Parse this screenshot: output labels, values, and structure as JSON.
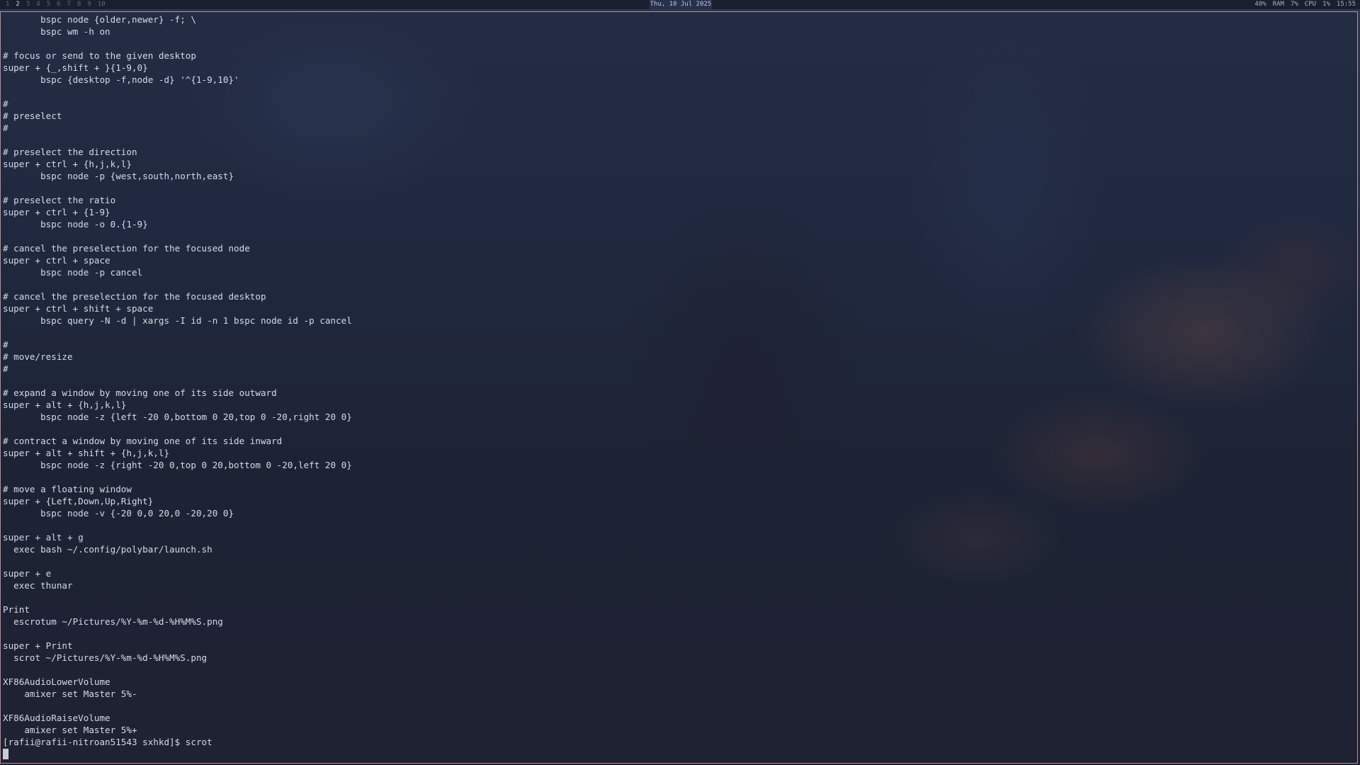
{
  "top_bar": {
    "workspaces": [
      "1",
      "2",
      "3",
      "4",
      "5",
      "6",
      "7",
      "8",
      "9",
      "10"
    ],
    "active_workspace": "2",
    "clock": "Thu, 10 Jul 2025",
    "stats": [
      "40%",
      "RAM",
      "7%",
      "CPU",
      "1%",
      "15:55"
    ]
  },
  "terminal": {
    "lines": [
      "       bspc node {older,newer} -f; \\",
      "       bspc wm -h on",
      "",
      "# focus or send to the given desktop",
      "super + {_,shift + }{1-9,0}",
      "       bspc {desktop -f,node -d} '^{1-9,10}'",
      "",
      "#",
      "# preselect",
      "#",
      "",
      "# preselect the direction",
      "super + ctrl + {h,j,k,l}",
      "       bspc node -p {west,south,north,east}",
      "",
      "# preselect the ratio",
      "super + ctrl + {1-9}",
      "       bspc node -o 0.{1-9}",
      "",
      "# cancel the preselection for the focused node",
      "super + ctrl + space",
      "       bspc node -p cancel",
      "",
      "# cancel the preselection for the focused desktop",
      "super + ctrl + shift + space",
      "       bspc query -N -d | xargs -I id -n 1 bspc node id -p cancel",
      "",
      "#",
      "# move/resize",
      "#",
      "",
      "# expand a window by moving one of its side outward",
      "super + alt + {h,j,k,l}",
      "       bspc node -z {left -20 0,bottom 0 20,top 0 -20,right 20 0}",
      "",
      "# contract a window by moving one of its side inward",
      "super + alt + shift + {h,j,k,l}",
      "       bspc node -z {right -20 0,top 0 20,bottom 0 -20,left 20 0}",
      "",
      "# move a floating window",
      "super + {Left,Down,Up,Right}",
      "       bspc node -v {-20 0,0 20,0 -20,20 0}",
      "",
      "super + alt + g",
      "  exec bash ~/.config/polybar/launch.sh",
      "",
      "super + e",
      "  exec thunar",
      "",
      "Print",
      "  escrotum ~/Pictures/%Y-%m-%d-%H%M%S.png",
      "",
      "super + Print",
      "  scrot ~/Pictures/%Y-%m-%d-%H%M%S.png",
      "",
      "XF86AudioLowerVolume",
      "    amixer set Master 5%-",
      "",
      "XF86AudioRaiseVolume",
      "    amixer set Master 5%+"
    ],
    "prompt": "[rafii@rafii-nitroan51543 sxhkd]$ scrot"
  }
}
